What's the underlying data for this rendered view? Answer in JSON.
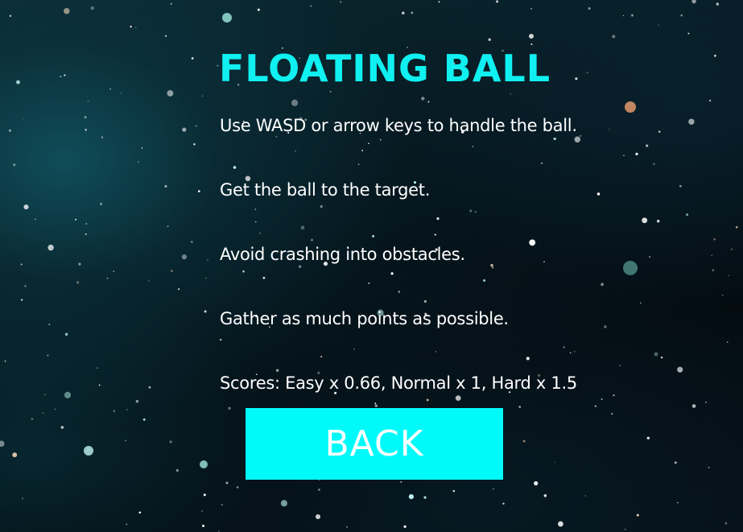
{
  "screen": {
    "title": "FLOATING BALL",
    "instructions": [
      "Use WASD or arrow keys to handle the ball.",
      "Get the ball to the target.",
      "Avoid crashing into obstacles.",
      "Gather as much points as possible.",
      "Scores: Easy x 0.66, Normal x 1, Hard x 1.5"
    ],
    "back_label": "BACK"
  },
  "colors": {
    "title": "#10f0f0",
    "button": "#00fafa",
    "text": "#ffffff",
    "background": "#061820"
  }
}
